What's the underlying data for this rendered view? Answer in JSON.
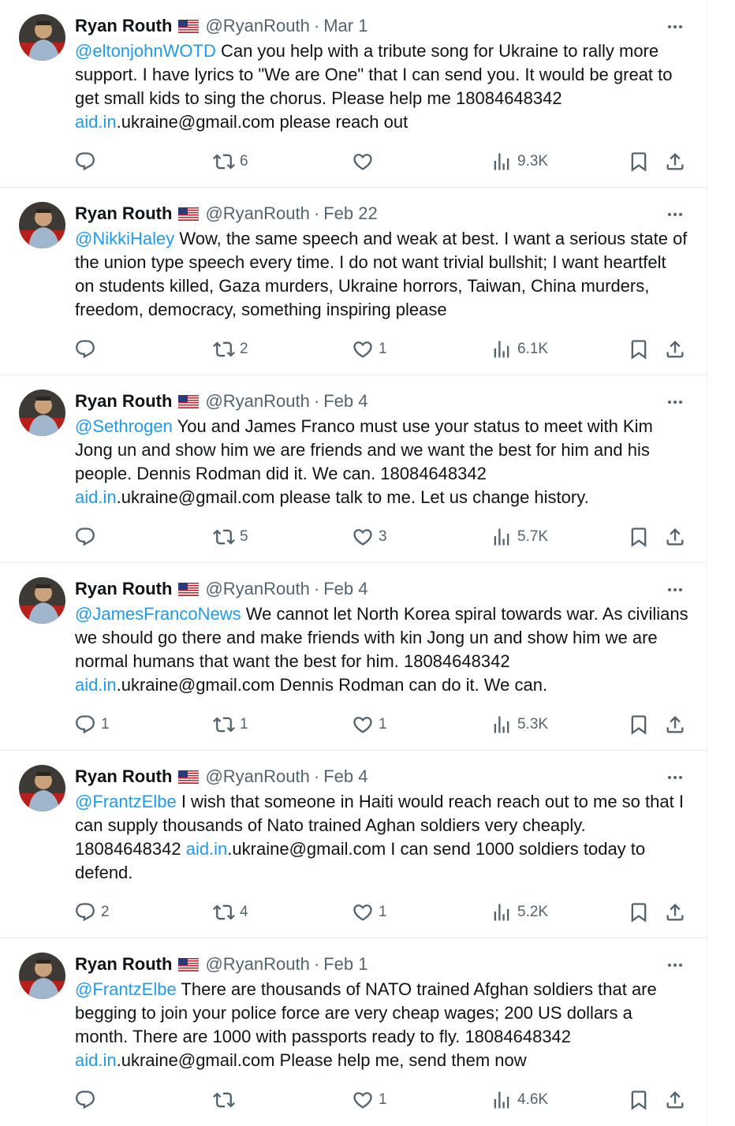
{
  "tweets": [
    {
      "name": "Ryan Routh",
      "handle": "@RyanRouth",
      "sep": "·",
      "date": "Mar 1",
      "mention": "@eltonjohnWOTD",
      "text1": " Can you help with a tribute song for Ukraine to rally more support. I have lyrics to \"We are One\" that I can send you. It would be great to get small kids to sing the chorus. Please help me 18084648342 ",
      "link": "aid.in",
      "text2": ".ukraine@gmail.com please reach out",
      "replies": "",
      "retweets": "6",
      "likes": "",
      "views": "9.3K"
    },
    {
      "name": "Ryan Routh",
      "handle": "@RyanRouth",
      "sep": "·",
      "date": "Feb 22",
      "mention": "@NikkiHaley",
      "text1": " Wow, the same speech and weak at best. I want a serious state of the union type speech every time. I do not want trivial bullshit; I want heartfelt on students killed, Gaza murders, Ukraine horrors, Taiwan, China murders, freedom, democracy, something inspiring please",
      "link": "",
      "text2": "",
      "replies": "",
      "retweets": "2",
      "likes": "1",
      "views": "6.1K"
    },
    {
      "name": "Ryan Routh",
      "handle": "@RyanRouth",
      "sep": "·",
      "date": "Feb 4",
      "mention": "@Sethrogen",
      "text1": " You and James Franco must use your status to meet with Kim Jong un and show him we are friends and we want the best for him and his people. Dennis Rodman did it. We can. 18084648342 ",
      "link": "aid.in",
      "text2": ".ukraine@gmail.com please talk to me. Let us change history.",
      "replies": "",
      "retweets": "5",
      "likes": "3",
      "views": "5.7K"
    },
    {
      "name": "Ryan Routh",
      "handle": "@RyanRouth",
      "sep": "·",
      "date": "Feb 4",
      "mention": "@JamesFrancoNews",
      "text1": " We cannot let North Korea spiral towards war. As civilians we should go there and make friends with kin Jong un and show him we are normal humans that want the best for him. 18084648342 ",
      "link": "aid.in",
      "text2": ".ukraine@gmail.com Dennis Rodman can do it. We can.",
      "replies": "1",
      "retweets": "1",
      "likes": "1",
      "views": "5.3K"
    },
    {
      "name": "Ryan Routh",
      "handle": "@RyanRouth",
      "sep": "·",
      "date": "Feb 4",
      "mention": "@FrantzElbe",
      "text1": " I wish that someone in Haiti would reach reach out to me so that I can supply thousands of Nato trained Aghan soldiers very cheaply. 18084648342 ",
      "link": "aid.in",
      "text2": ".ukraine@gmail.com I can send 1000 soldiers today to defend.",
      "replies": "2",
      "retweets": "4",
      "likes": "1",
      "views": "5.2K"
    },
    {
      "name": "Ryan Routh",
      "handle": "@RyanRouth",
      "sep": "·",
      "date": "Feb 1",
      "mention": "@FrantzElbe",
      "text1": " There are thousands of NATO trained Afghan soldiers that are begging to join your police force are very cheap wages; 200 US dollars a month. There are 1000 with passports ready to fly. 18084648342 ",
      "link": "aid.in",
      "text2": ".ukraine@gmail.com Please help me, send them now",
      "replies": "",
      "retweets": "",
      "likes": "1",
      "views": "4.6K"
    }
  ],
  "icons": {
    "more": "more-horizontal-icon",
    "reply": "reply-icon",
    "retweet": "retweet-icon",
    "like": "heart-icon",
    "views": "views-chart-icon",
    "bookmark": "bookmark-icon",
    "share": "share-icon",
    "flag": "us-flag-icon"
  },
  "colors": {
    "text": "#0f1419",
    "secondary": "#536471",
    "link": "#1d9bf0",
    "divider": "#e7e9ea"
  }
}
